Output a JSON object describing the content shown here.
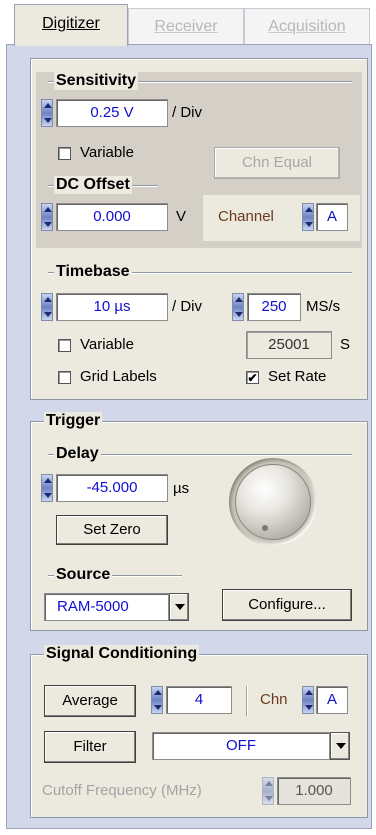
{
  "tabs": [
    {
      "label": "Digitizer",
      "active": true
    },
    {
      "label": "Receiver",
      "active": false
    },
    {
      "label": "Acquisition",
      "active": false
    }
  ],
  "sensitivity": {
    "title": "Sensitivity",
    "value": "0.25 V",
    "unit": "/ Div",
    "variable_label": "Variable",
    "variable_checked": false,
    "chn_equal_label": "Chn Equal"
  },
  "dc_offset": {
    "title": "DC Offset",
    "value": "0.000",
    "unit": "V",
    "channel_label": "Channel",
    "channel_value": "A"
  },
  "timebase": {
    "title": "Timebase",
    "value": "10 µs",
    "unit": "/ Div",
    "rate_value": "250",
    "rate_unit": "MS/s",
    "variable_label": "Variable",
    "variable_checked": false,
    "samples_value": "25001",
    "samples_unit": "S",
    "grid_labels_label": "Grid Labels",
    "grid_labels_checked": false,
    "set_rate_label": "Set Rate",
    "set_rate_checked": true
  },
  "trigger": {
    "title": "Trigger",
    "delay_title": "Delay",
    "delay_value": "-45.000",
    "delay_unit": "µs",
    "set_zero_label": "Set Zero",
    "source_title": "Source",
    "source_value": "RAM-5000",
    "configure_label": "Configure..."
  },
  "signal_conditioning": {
    "title": "Signal Conditioning",
    "average_label": "Average",
    "average_value": "4",
    "chn_label": "Chn",
    "chn_value": "A",
    "filter_label": "Filter",
    "filter_value": "OFF",
    "cutoff_label": "Cutoff Frequency (MHz)",
    "cutoff_value": "1.000"
  },
  "colors": {
    "panel_bg": "#d2d8ea",
    "group_bg": "#ece9df",
    "sub_group_bg": "#d4d0c8",
    "field_text": "#1010d0",
    "channel_label": "#6b3b1b"
  },
  "check_glyph": "✔"
}
